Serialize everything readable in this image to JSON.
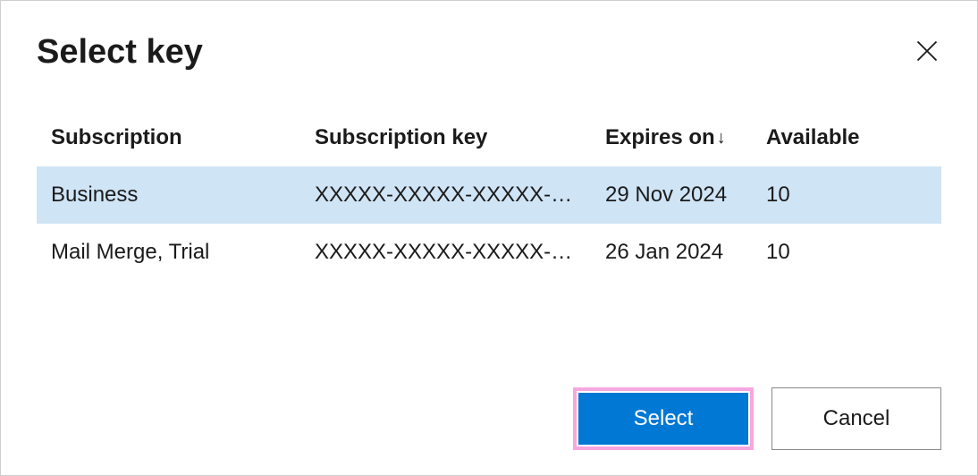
{
  "dialog": {
    "title": "Select key"
  },
  "table": {
    "headers": {
      "subscription": "Subscription",
      "key": "Subscription key",
      "expires": "Expires on",
      "sort_arrow": "↓",
      "available": "Available"
    },
    "rows": [
      {
        "subscription": "Business",
        "key": "XXXXX-XXXXX-XXXXX-XXXXX",
        "expires": "29 Nov 2024",
        "available": "10",
        "selected": true
      },
      {
        "subscription": "Mail Merge, Trial",
        "key": "XXXXX-XXXXX-XXXXX-XXXXX",
        "expires": "26 Jan 2024",
        "available": "10",
        "selected": false
      }
    ]
  },
  "buttons": {
    "select": "Select",
    "cancel": "Cancel"
  }
}
